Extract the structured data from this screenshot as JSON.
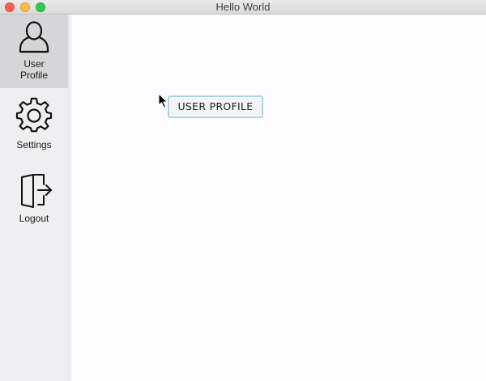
{
  "window": {
    "title": "Hello World",
    "controls": {
      "close": "close-button",
      "minimize": "minimize-button",
      "zoom": "zoom-button"
    }
  },
  "sidebar": {
    "items": [
      {
        "label": "User Profile",
        "icon": "user-icon",
        "active": true
      },
      {
        "label": "Settings",
        "icon": "gear-icon",
        "active": false
      },
      {
        "label": "Logout",
        "icon": "logout-icon",
        "active": false
      }
    ]
  },
  "main": {
    "button_label": "USER PROFILE"
  },
  "colors": {
    "active_nav_bg": "#d6d6d8",
    "sidebar_bg": "#efeef0",
    "button_focus_ring": "#a9d2e4"
  }
}
